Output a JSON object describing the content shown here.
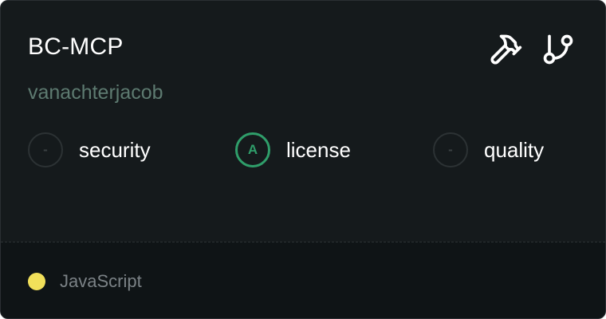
{
  "repo": {
    "name": "BC-MCP",
    "owner": "vanachterjacob"
  },
  "actions": [
    {
      "icon": "hammer-icon"
    },
    {
      "icon": "git-branch-icon"
    }
  ],
  "metrics": [
    {
      "label": "security",
      "grade": "-"
    },
    {
      "label": "license",
      "grade": "A"
    },
    {
      "label": "quality",
      "grade": "-"
    }
  ],
  "footer": {
    "language": "JavaScript",
    "language_color": "#f1e05a"
  },
  "colors": {
    "grade_a": "#2f9e6a",
    "owner_text": "#5d7a70"
  }
}
